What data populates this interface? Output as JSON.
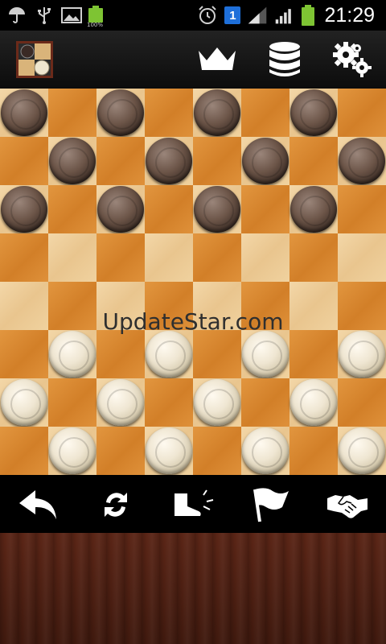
{
  "status_bar": {
    "battery_small_label": "100%",
    "sim_label": "1",
    "time": "21:29",
    "icons": [
      "umbrella-icon",
      "usb-icon",
      "image-icon",
      "battery-small-icon",
      "alarm-icon",
      "sim-icon",
      "signal-icon",
      "signal-icon",
      "battery-icon"
    ]
  },
  "toolbar": {
    "app_icon": "checkers-app-icon",
    "buttons": [
      {
        "name": "crown-button",
        "icon": "crown-icon"
      },
      {
        "name": "database-button",
        "icon": "database-icon"
      },
      {
        "name": "settings-button",
        "icon": "gears-icon"
      }
    ]
  },
  "board": {
    "size": 8,
    "light_square_color": "#f0d29f",
    "dark_square_color": "#d8892f",
    "dark_piece_color": "#5c4538",
    "light_piece_color": "#e9dfc6",
    "pieces": [
      {
        "row": 0,
        "col": 0,
        "color": "dark"
      },
      {
        "row": 0,
        "col": 2,
        "color": "dark"
      },
      {
        "row": 0,
        "col": 4,
        "color": "dark"
      },
      {
        "row": 0,
        "col": 6,
        "color": "dark"
      },
      {
        "row": 1,
        "col": 1,
        "color": "dark"
      },
      {
        "row": 1,
        "col": 3,
        "color": "dark"
      },
      {
        "row": 1,
        "col": 5,
        "color": "dark"
      },
      {
        "row": 1,
        "col": 7,
        "color": "dark"
      },
      {
        "row": 2,
        "col": 0,
        "color": "dark"
      },
      {
        "row": 2,
        "col": 2,
        "color": "dark"
      },
      {
        "row": 2,
        "col": 4,
        "color": "dark"
      },
      {
        "row": 2,
        "col": 6,
        "color": "dark"
      },
      {
        "row": 5,
        "col": 1,
        "color": "light"
      },
      {
        "row": 5,
        "col": 3,
        "color": "light"
      },
      {
        "row": 5,
        "col": 5,
        "color": "light"
      },
      {
        "row": 5,
        "col": 7,
        "color": "light"
      },
      {
        "row": 6,
        "col": 0,
        "color": "light"
      },
      {
        "row": 6,
        "col": 2,
        "color": "light"
      },
      {
        "row": 6,
        "col": 4,
        "color": "light"
      },
      {
        "row": 6,
        "col": 6,
        "color": "light"
      },
      {
        "row": 7,
        "col": 1,
        "color": "light"
      },
      {
        "row": 7,
        "col": 3,
        "color": "light"
      },
      {
        "row": 7,
        "col": 5,
        "color": "light"
      },
      {
        "row": 7,
        "col": 7,
        "color": "light"
      }
    ]
  },
  "watermark": "UpdateStar.com",
  "action_bar": {
    "buttons": [
      {
        "name": "undo-button",
        "icon": "undo-arrow-icon"
      },
      {
        "name": "rotate-board-button",
        "icon": "refresh-icon"
      },
      {
        "name": "kick-button",
        "icon": "boot-kick-icon"
      },
      {
        "name": "surrender-button",
        "icon": "flag-icon"
      },
      {
        "name": "offer-draw-button",
        "icon": "handshake-icon"
      }
    ]
  }
}
